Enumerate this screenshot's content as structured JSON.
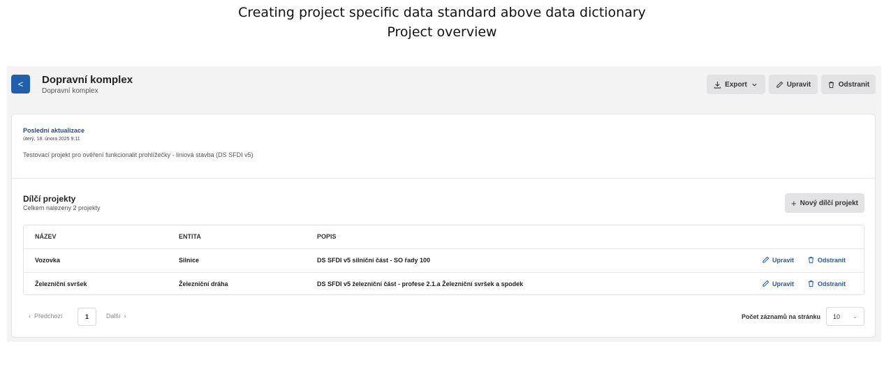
{
  "slide": {
    "title_line1": "Creating project specific data standard above data dictionary",
    "title_line2": "Project overview"
  },
  "header": {
    "back_label": "<",
    "title": "Dopravní komplex",
    "subtitle": "Dopravní komplex",
    "export_label": "Export",
    "edit_label": "Upravit",
    "delete_label": "Odstranit"
  },
  "info": {
    "updated_label": "Poslední aktualizace",
    "updated_value": "úterý, 18. února 2025 9:11",
    "description": "Testovací projekt pro ověření funkcionalit prohlížečky - liniová stavba (DS SFDI v5)"
  },
  "subprojects": {
    "title": "Dílčí projekty",
    "count_text": "Celkem nalezeny 2 projekty",
    "new_button_label": "Nový dílčí projekt",
    "columns": [
      "NÁZEV",
      "ENTITA",
      "POPIS"
    ],
    "rows": [
      {
        "name": "Vozovka",
        "entity": "Silnice",
        "description": "DS SFDI v5 silniční část - SO řady 100",
        "edit": "Upravit",
        "delete": "Odstranit"
      },
      {
        "name": "Železniční svršek",
        "entity": "Železniční dráha",
        "description": "DS SFDI v5 železniční část - profese 2.1.a Železniční svršek a spodek",
        "edit": "Upravit",
        "delete": "Odstranit"
      }
    ]
  },
  "pagination": {
    "prev_label": "Předchozí",
    "current_page": "1",
    "next_label": "Další",
    "per_page_label": "Počet záznamů na stránku",
    "per_page_value": "10"
  },
  "colors": {
    "accent": "#1f5fad",
    "background": "#f3f3f4",
    "button_bg": "#e3e3e5"
  },
  "icons": {
    "back": "chevron-left-icon",
    "export": "download-icon",
    "edit": "pencil-icon",
    "delete": "trash-icon",
    "add": "plus-icon"
  }
}
